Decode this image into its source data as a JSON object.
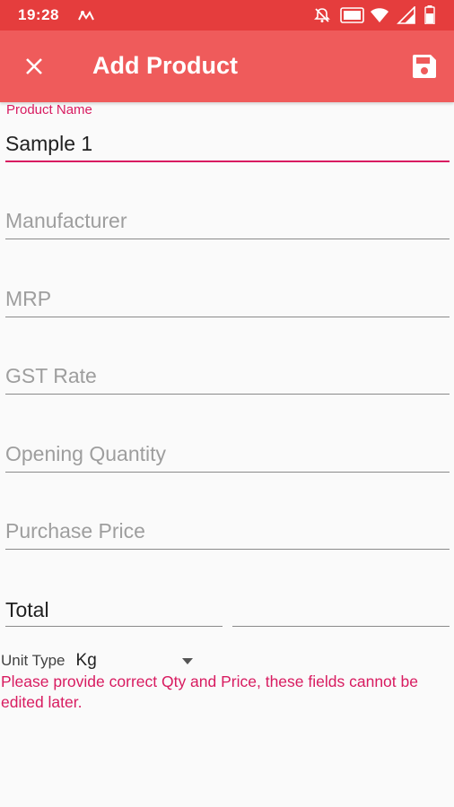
{
  "status_bar": {
    "time": "19:28"
  },
  "app_bar": {
    "title": "Add Product",
    "close_icon": "close-icon",
    "save_icon": "save-icon"
  },
  "form": {
    "product_name": {
      "label": "Product Name",
      "value": "Sample 1"
    },
    "manufacturer": {
      "placeholder": "Manufacturer"
    },
    "mrp": {
      "placeholder": "MRP"
    },
    "gst_rate": {
      "placeholder": "GST Rate"
    },
    "opening_quantity": {
      "placeholder": "Opening Quantity"
    },
    "purchase_price": {
      "placeholder": "Purchase Price"
    },
    "total": {
      "value": "Total"
    },
    "unit_type": {
      "label": "Unit Type",
      "value": "Kg"
    },
    "warning": "Please provide correct Qty and Price, these fields cannot be edited later."
  },
  "colors": {
    "status_bar": "#e53d3d",
    "app_bar": "#ef5b5b",
    "accent": "#d81b60"
  }
}
